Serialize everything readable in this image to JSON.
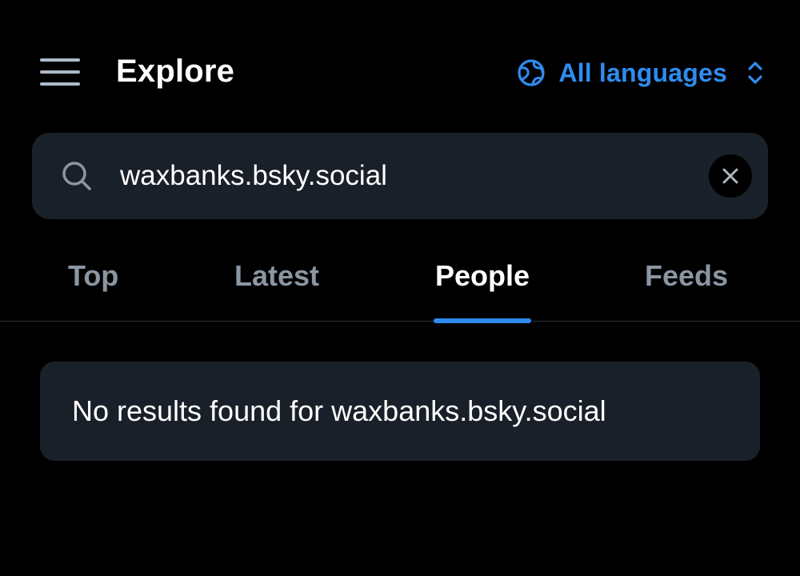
{
  "header": {
    "title": "Explore",
    "menu_icon": "hamburger-menu-icon",
    "language": {
      "label": "All languages",
      "icon": "globe-icon",
      "chevron_icon": "chevron-up-down-icon"
    }
  },
  "search": {
    "icon": "search-icon",
    "value": "waxbanks.bsky.social",
    "clear_icon": "close-icon"
  },
  "tabs": [
    {
      "label": "Top",
      "active": false
    },
    {
      "label": "Latest",
      "active": false
    },
    {
      "label": "People",
      "active": true
    },
    {
      "label": "Feeds",
      "active": false
    }
  ],
  "results": {
    "empty_message": "No results found for waxbanks.bsky.social"
  },
  "colors": {
    "background": "#000000",
    "surface": "#1a2029",
    "accent": "#2f8cf0",
    "muted_text": "#8b96a3",
    "icon": "#aebbc9"
  }
}
